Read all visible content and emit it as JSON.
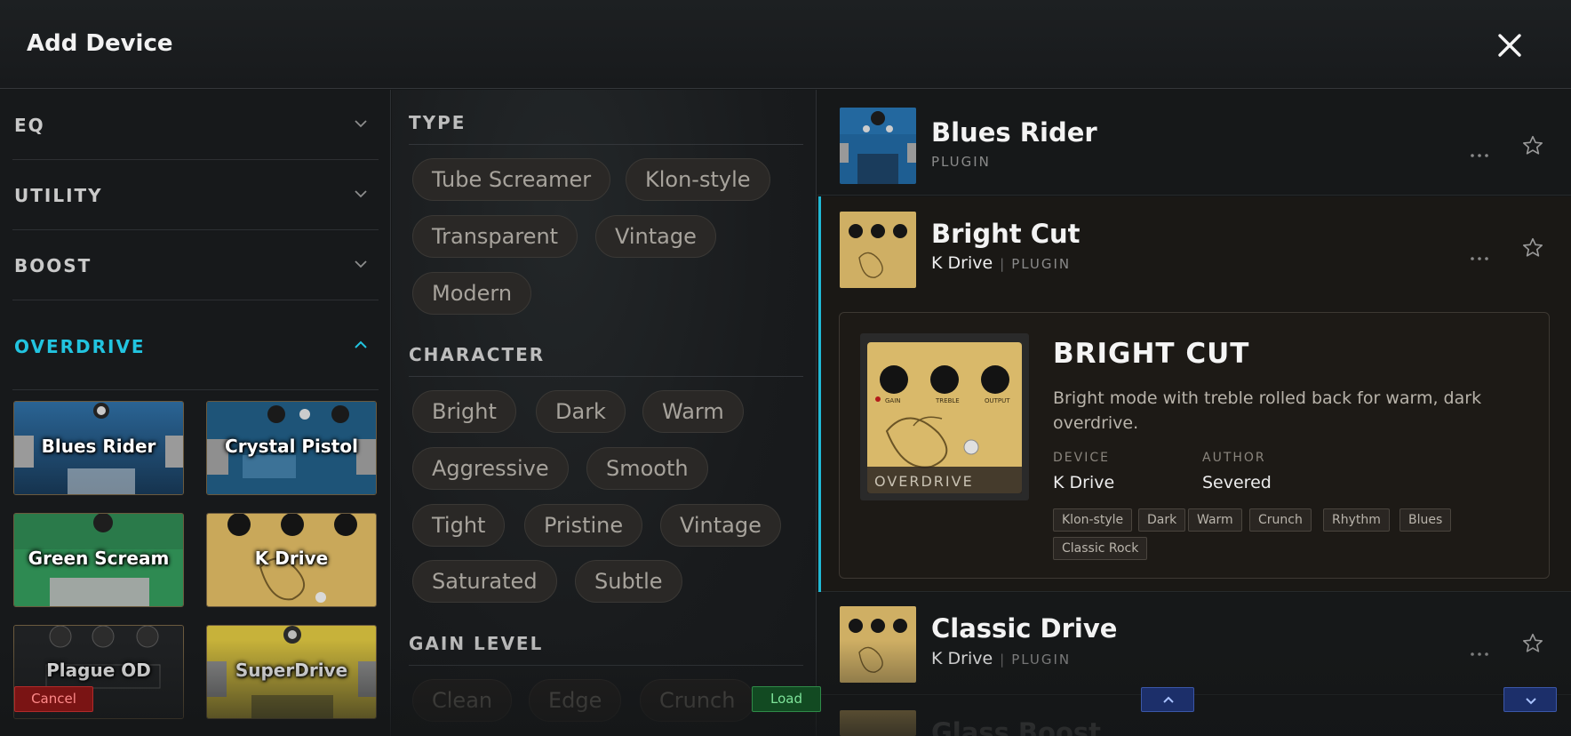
{
  "header": {
    "title": "Add Device"
  },
  "categories": [
    {
      "label": "EQ",
      "expanded": false
    },
    {
      "label": "UTILITY",
      "expanded": false
    },
    {
      "label": "BOOST",
      "expanded": false
    },
    {
      "label": "OVERDRIVE",
      "expanded": true
    }
  ],
  "tiles": [
    {
      "label": "Blues Rider",
      "theme": "blue"
    },
    {
      "label": "Crystal Pistol",
      "theme": "blue"
    },
    {
      "label": "Green Scream",
      "theme": "green"
    },
    {
      "label": "K Drive",
      "theme": "gold"
    },
    {
      "label": "Plague OD",
      "theme": "dark"
    },
    {
      "label": "SuperDrive",
      "theme": "yellow"
    }
  ],
  "filters": {
    "type": {
      "title": "TYPE",
      "chips": [
        "Tube Screamer",
        "Klon-style",
        "Transparent",
        "Vintage",
        "Modern"
      ]
    },
    "character": {
      "title": "CHARACTER",
      "chips": [
        "Bright",
        "Dark",
        "Warm",
        "Aggressive",
        "Smooth",
        "Tight",
        "Pristine",
        "Vintage",
        "Saturated",
        "Subtle"
      ]
    },
    "gain_level": {
      "title": "GAIN LEVEL",
      "chips": [
        "Clean",
        "Edge",
        "Crunch"
      ]
    }
  },
  "devices": [
    {
      "name": "Blues Rider",
      "device": "",
      "kind": "PLUGIN",
      "theme": "blue"
    },
    {
      "name": "Bright Cut",
      "device": "K Drive",
      "kind": "PLUGIN",
      "theme": "gold",
      "selected": true
    },
    {
      "name": "Classic Drive",
      "device": "K Drive",
      "kind": "PLUGIN",
      "theme": "gold"
    },
    {
      "name": "Glass Boost",
      "device": "",
      "kind": "",
      "theme": "gold"
    }
  ],
  "detail": {
    "title": "BRIGHT CUT",
    "description": "Bright mode with treble rolled back for warm, dark overdrive.",
    "device_label": "DEVICE",
    "device_value": "K Drive",
    "author_label": "AUTHOR",
    "author_value": "Severed",
    "image_caption": "OVERDRIVE",
    "knob_labels": [
      "GAIN",
      "TREBLE",
      "OUTPUT"
    ],
    "tags": [
      "Klon-style",
      "Dark",
      "Warm",
      "Crunch",
      "Rhythm",
      "Blues",
      "Classic Rock"
    ]
  },
  "buttons": {
    "cancel": "Cancel",
    "load": "Load"
  },
  "colors": {
    "accent": "#22c4e0",
    "cancel": "#7a1414",
    "load": "#124a22",
    "nav": "#1c2f6a"
  },
  "icons": {
    "close": "close-icon",
    "chevron": "chevron-down-icon",
    "more": "more-horizontal-icon",
    "star": "star-outline-icon"
  }
}
